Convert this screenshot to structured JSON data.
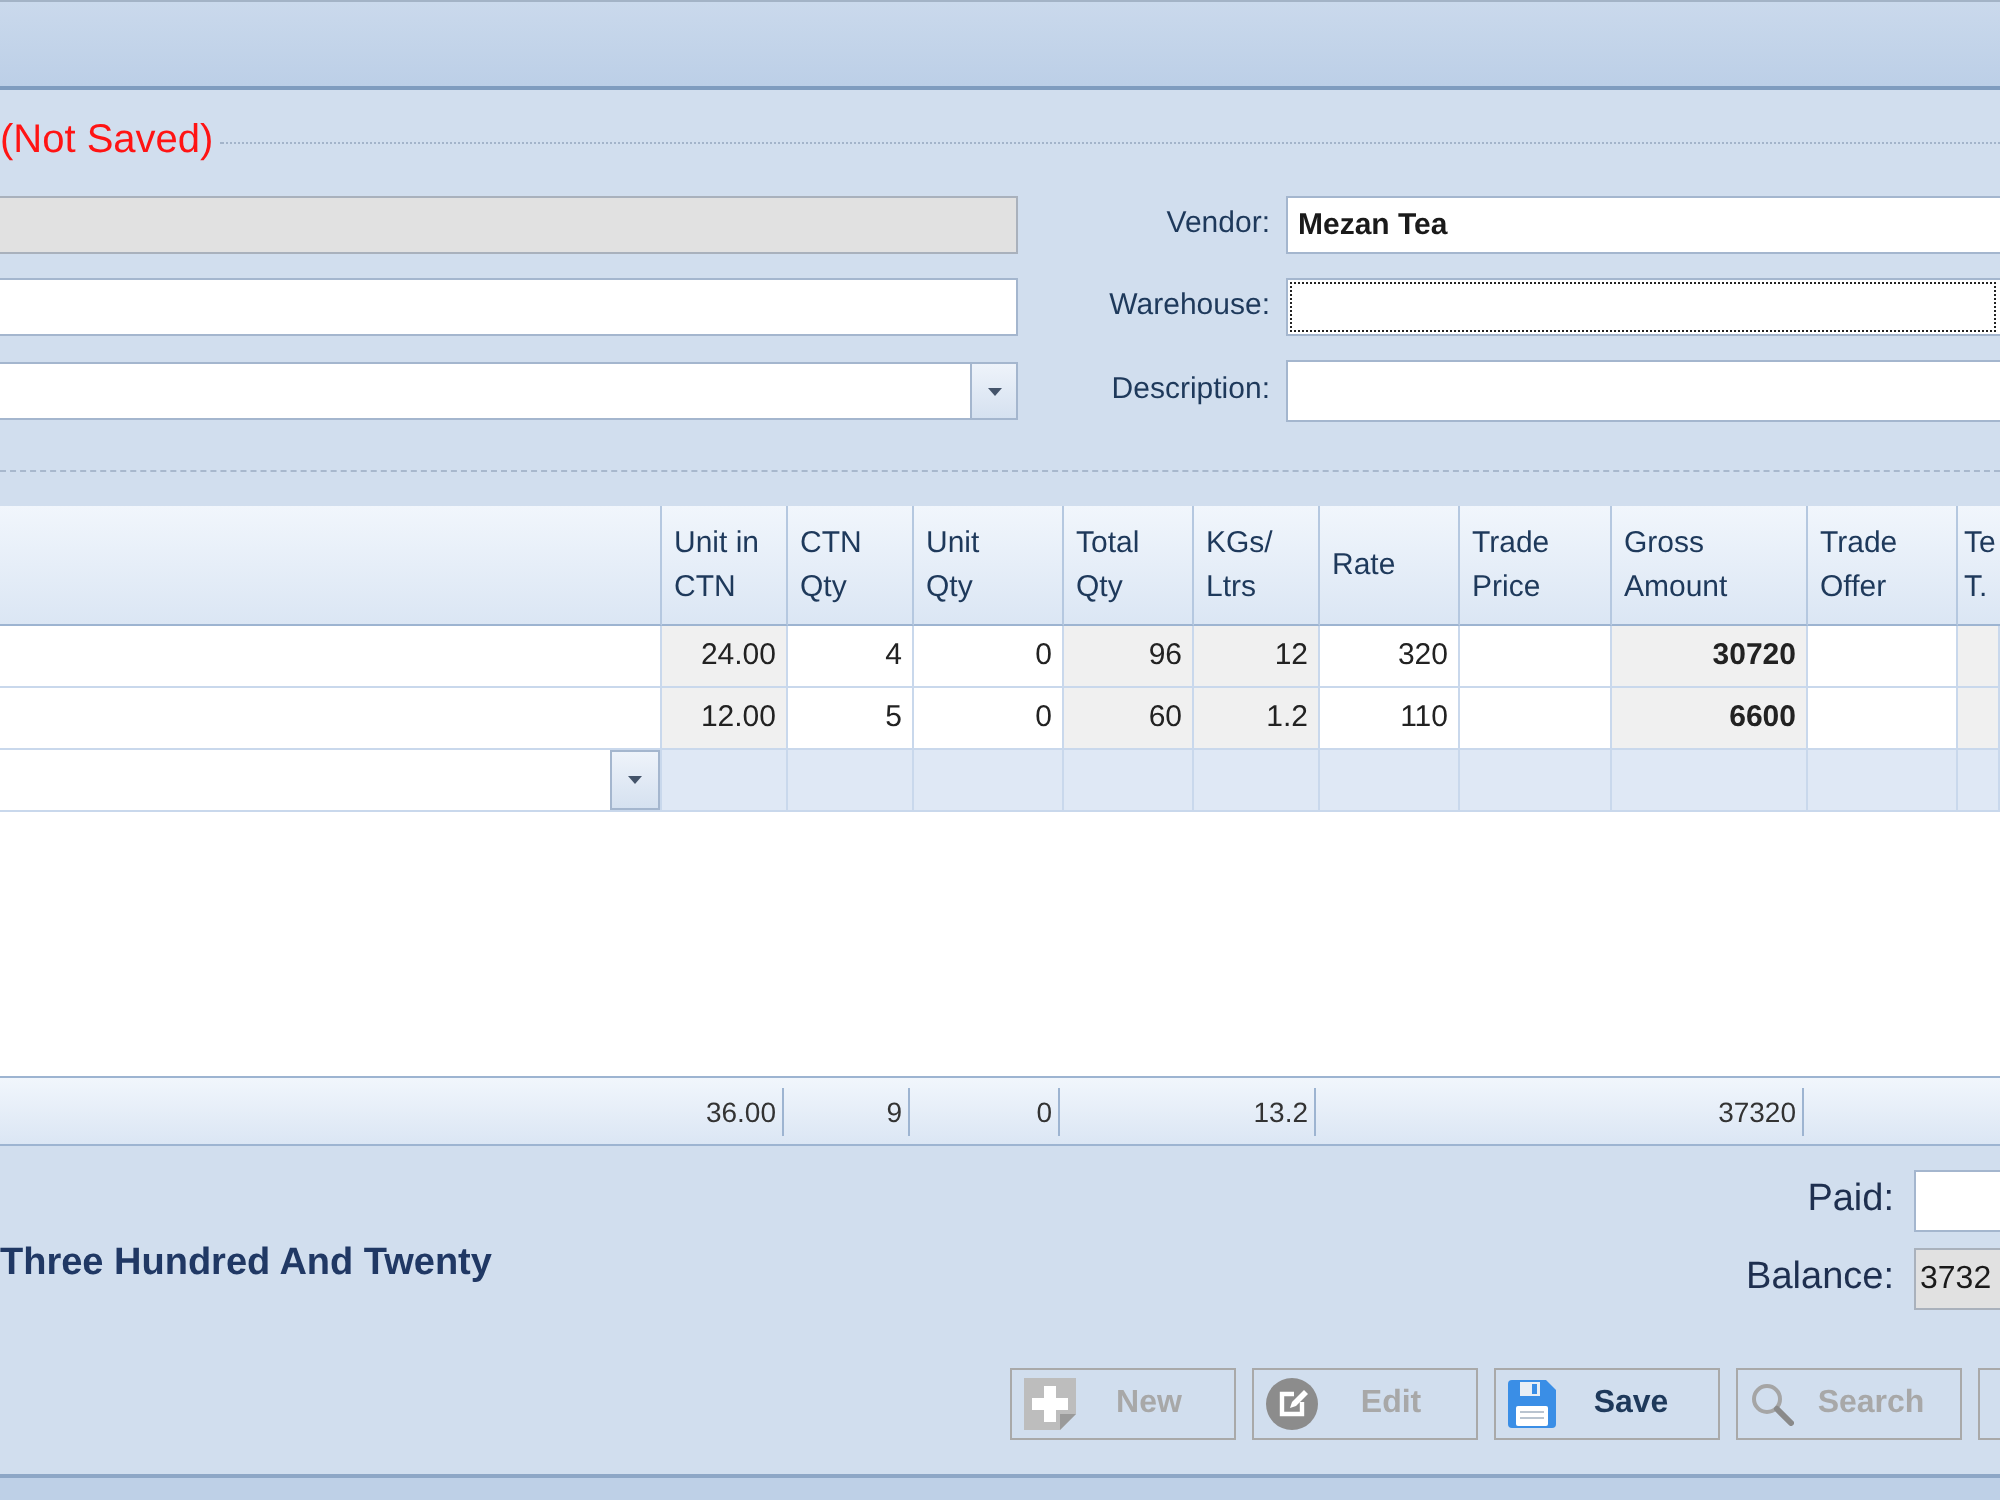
{
  "group_title": "(Not Saved)",
  "left_fields": [
    {
      "kind": "text",
      "disabled": true
    },
    {
      "kind": "text",
      "disabled": false
    },
    {
      "kind": "combo",
      "disabled": false
    }
  ],
  "right_fields": [
    {
      "label": "Vendor:",
      "value": "Mezan Tea",
      "focused": false
    },
    {
      "label": "Warehouse:",
      "focused": true
    },
    {
      "label": "Description:",
      "focused": false
    }
  ],
  "grid": {
    "columns": [
      {
        "kind": "lookup"
      },
      {
        "label": "Unit in\nCTN",
        "kind": "calculated",
        "total": "36.00"
      },
      {
        "label": "CTN\nQty",
        "kind": "editable",
        "total": "9"
      },
      {
        "label": "Unit\nQty",
        "kind": "editable",
        "total": "0"
      },
      {
        "label": "Total\nQty",
        "kind": "calculated"
      },
      {
        "label": "KGs/\nLtrs",
        "kind": "calculated",
        "total": "13.2"
      },
      {
        "label": "Rate",
        "kind": "editable"
      },
      {
        "label": "Trade\nPrice",
        "kind": "editable"
      },
      {
        "label": "Gross\nAmount",
        "kind": "amount",
        "total": "37320"
      },
      {
        "label": "Trade\nOffer",
        "kind": "editable"
      },
      {
        "label": "Te\nT.",
        "kind": "calculated"
      }
    ],
    "rows": [
      {
        "kind": "data",
        "cells": [
          null,
          "24.00",
          "4",
          "0",
          "96",
          "12",
          "320",
          null,
          "30720",
          null,
          null
        ]
      },
      {
        "kind": "data",
        "cells": [
          null,
          "12.00",
          "5",
          "0",
          "60",
          "1.2",
          "110",
          null,
          "6600",
          null,
          null
        ]
      },
      {
        "kind": "new"
      }
    ]
  },
  "amount_in_words": "Three Hundred And Twenty",
  "payment_fields": [
    {
      "label": "Paid:",
      "disabled": false
    },
    {
      "label": "Balance:",
      "value": "3732",
      "disabled": true
    }
  ],
  "buttons": [
    {
      "kind": "new",
      "label": "New",
      "disabled": true
    },
    {
      "kind": "edit",
      "label": "Edit",
      "disabled": true
    },
    {
      "kind": "save",
      "label": "Save",
      "disabled": false
    },
    {
      "kind": "search",
      "label": "Search",
      "disabled": true
    },
    {
      "kind": "partial"
    }
  ]
}
